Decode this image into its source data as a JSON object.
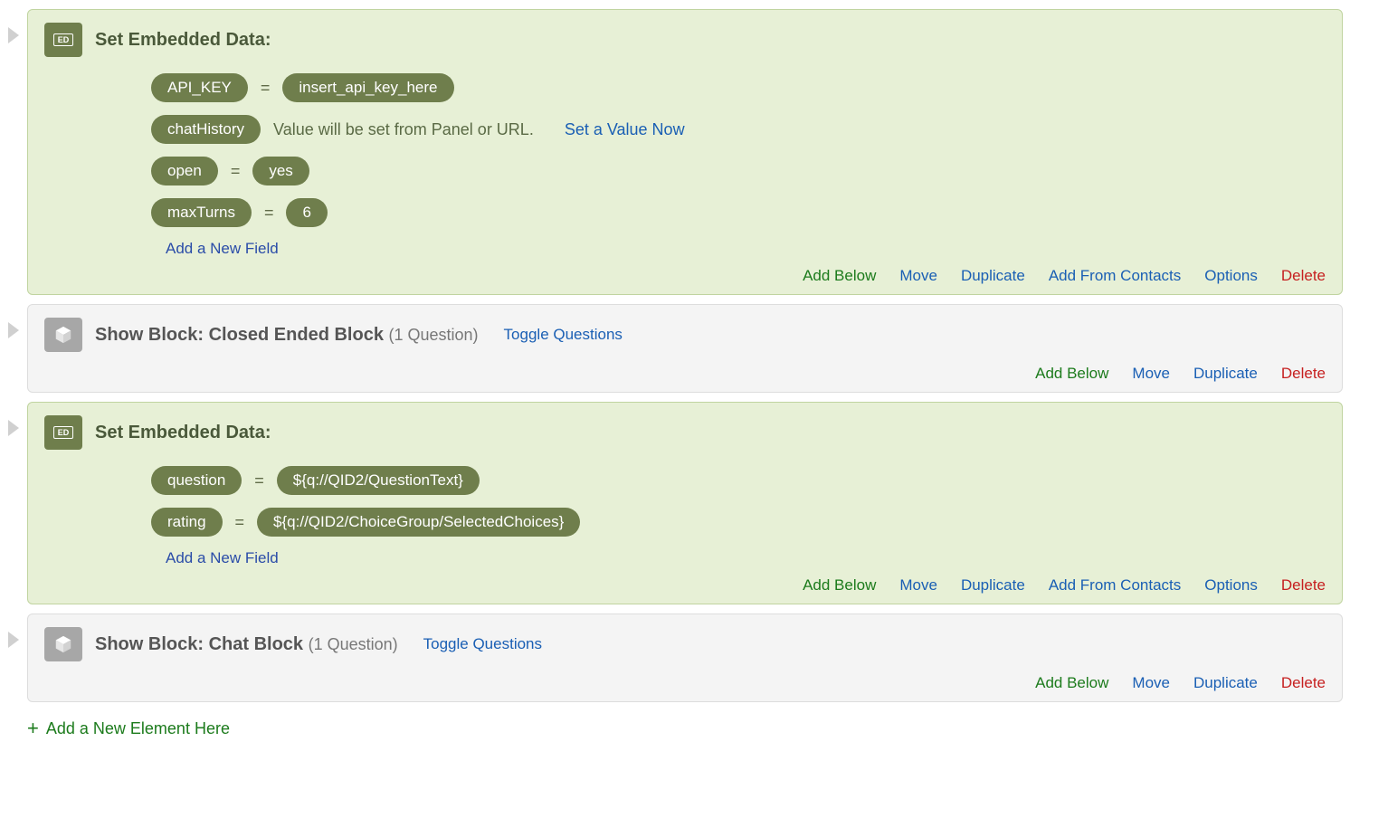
{
  "labels": {
    "ed_badge": "ED",
    "set_embedded_data": "Set Embedded Data:",
    "equals": "=",
    "value_from_panel": "Value will be set from Panel or URL.",
    "set_value_now": "Set a Value Now",
    "add_field": "Add a New Field",
    "add_below": "Add Below",
    "move": "Move",
    "duplicate": "Duplicate",
    "add_from_contacts": "Add From Contacts",
    "options": "Options",
    "delete": "Delete",
    "toggle_questions": "Toggle Questions",
    "add_element": "Add a New Element Here"
  },
  "block1": {
    "fields": [
      {
        "name": "API_KEY",
        "value": "insert_api_key_here",
        "has_value": true
      },
      {
        "name": "chatHistory",
        "has_value": false
      },
      {
        "name": "open",
        "value": "yes",
        "has_value": true
      },
      {
        "name": "maxTurns",
        "value": "6",
        "has_value": true
      }
    ]
  },
  "showBlock1": {
    "title": "Show Block: Closed Ended Block",
    "count": "(1 Question)"
  },
  "block2": {
    "fields": [
      {
        "name": "question",
        "value": "${q://QID2/QuestionText}",
        "has_value": true
      },
      {
        "name": "rating",
        "value": "${q://QID2/ChoiceGroup/SelectedChoices}",
        "has_value": true
      }
    ]
  },
  "showBlock2": {
    "title": "Show Block: Chat Block",
    "count": "(1 Question)"
  }
}
